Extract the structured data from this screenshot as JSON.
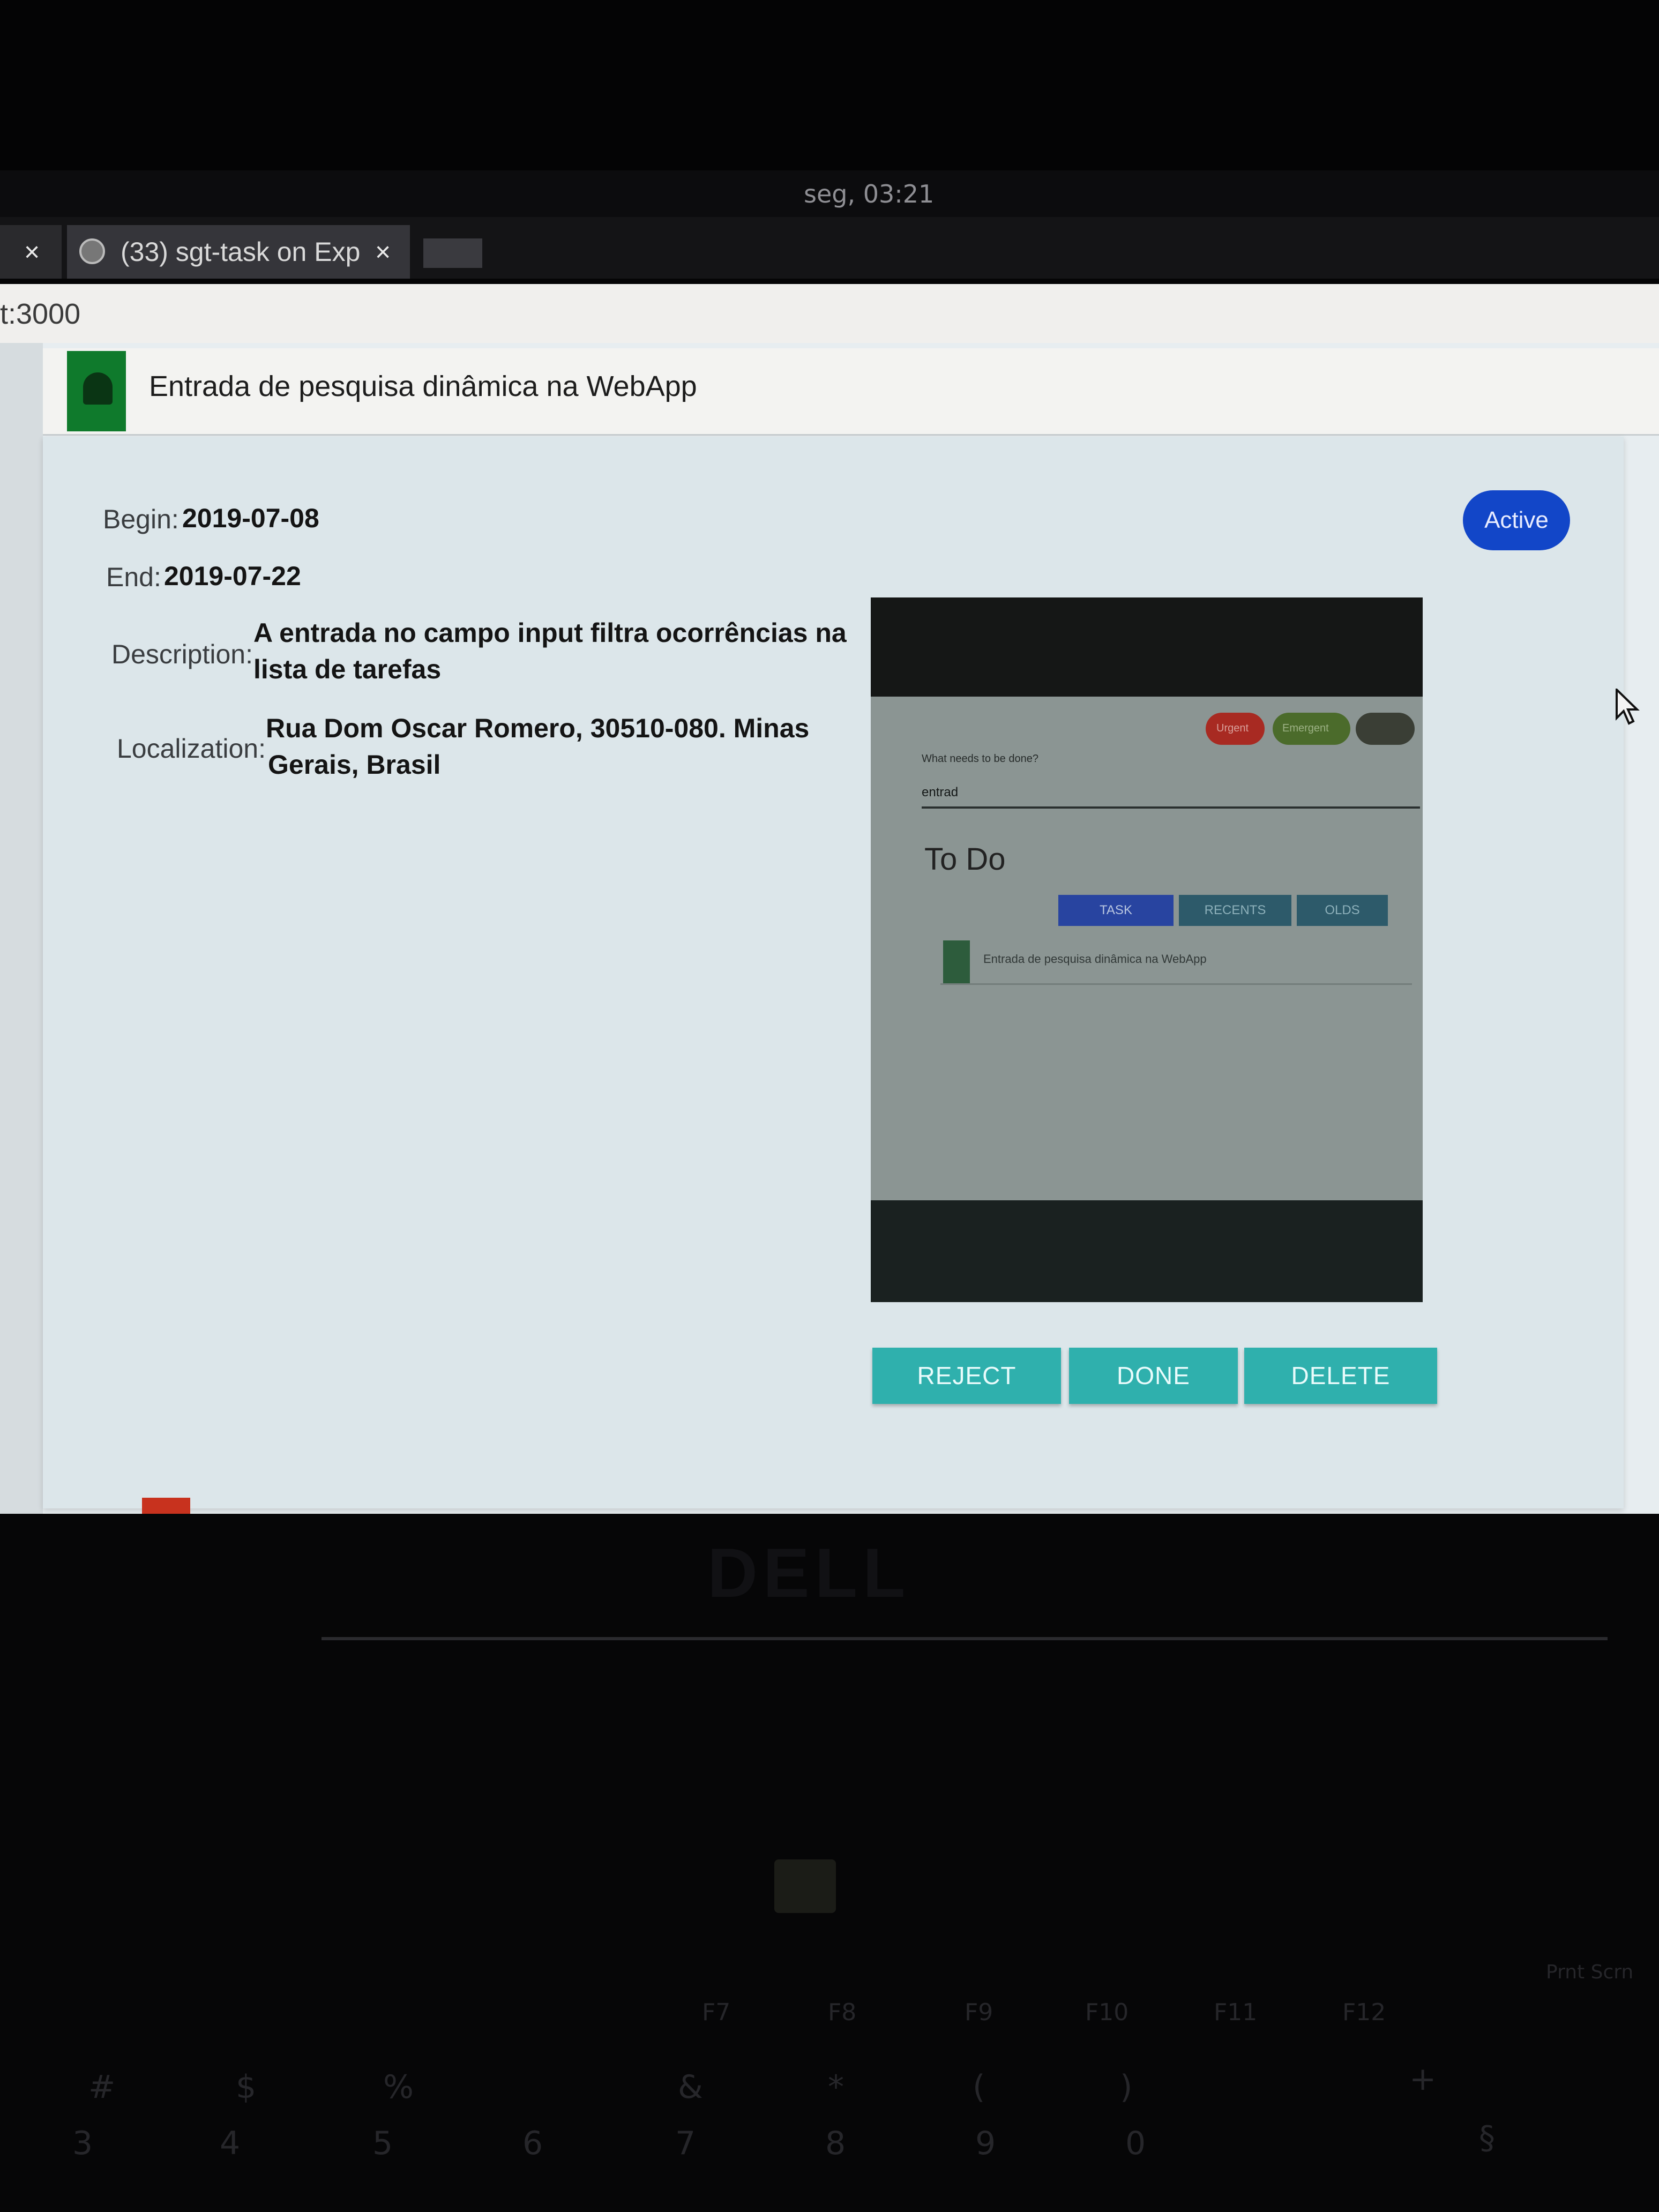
{
  "os": {
    "clock": "seg, 03:21"
  },
  "browser": {
    "tab_a_close": "×",
    "tab_b_title": "(33) sgt-task on Exp",
    "tab_b_close": "×",
    "address": "t:3000"
  },
  "task_row": {
    "title": "Entrada de pesquisa dinâmica na WebApp"
  },
  "details": {
    "begin_label": "Begin:",
    "begin_value": "2019-07-08",
    "end_label": "End:",
    "end_value": "2019-07-22",
    "description_label": "Description:",
    "description_line1": "A entrada no campo input filtra ocorrências na",
    "description_line2": "lista de tarefas",
    "localization_label": "Localization:",
    "localization_line1": "Rua Dom Oscar Romero, 30510-080. Minas",
    "localization_line2": "Gerais, Brasil",
    "status": "Active"
  },
  "preview": {
    "prompt": "What needs to be done?",
    "input_value": "entrad",
    "heading": "To Do",
    "tab_task": "TASK",
    "tab_recents": "RECENTS",
    "tab_olds": "OLDS",
    "item_text": "Entrada de pesquisa dinâmica na WebApp",
    "chip_urgent": "Urgent",
    "chip_emergent": "Emergent"
  },
  "actions": {
    "reject": "REJECT",
    "done": "DONE",
    "delete": "DELETE"
  },
  "keyboard": {
    "prt_scr": "Prnt Scrn",
    "f7": "F7",
    "f8": "F8",
    "f9": "F9",
    "f10": "F10",
    "f11": "F11",
    "f12": "F12",
    "k3": "3",
    "k4": "4",
    "k5": "5",
    "k6": "6",
    "k7": "7",
    "k8": "8",
    "k9": "9",
    "k0": "0",
    "hash": "#",
    "dollar": "$",
    "percent": "%",
    "amp": "&",
    "star": "*",
    "lparen": "(",
    "rparen": ")",
    "plus": "+",
    "section": "§"
  },
  "colors": {
    "status_badge": "#1246c8",
    "action_button": "#2fb0ad",
    "task_status_bar": "#0f7a2c"
  }
}
